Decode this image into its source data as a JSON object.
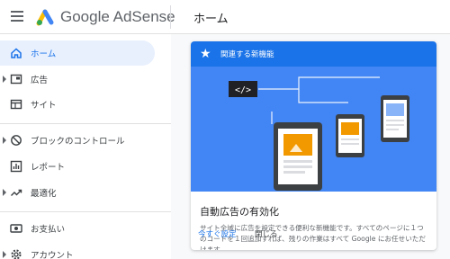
{
  "header": {
    "brand": "Google AdSense",
    "page_title": "ホーム"
  },
  "sidebar": {
    "items": [
      {
        "label": "ホーム",
        "icon": "home-icon",
        "active": true
      },
      {
        "label": "広告",
        "icon": "ads-icon",
        "expandable": true
      },
      {
        "label": "サイト",
        "icon": "sites-icon"
      },
      {
        "label": "ブロックのコントロール",
        "icon": "block-icon",
        "expandable": true
      },
      {
        "label": "レポート",
        "icon": "reports-icon"
      },
      {
        "label": "最適化",
        "icon": "optimization-icon",
        "expandable": true
      },
      {
        "label": "お支払い",
        "icon": "payments-icon"
      },
      {
        "label": "アカウント",
        "icon": "account-icon",
        "expandable": true
      }
    ]
  },
  "card": {
    "tag": "関連する新機能",
    "title": "自動広告の有効化",
    "description": "サイト全域に広告を設定できる便利な新機能です。すべてのページに１つのコードを１回追加すれば、残りの作業はすべて Google にお任せいただけます。",
    "primary_action": "今すぐ設定",
    "secondary_action": "閉じる"
  },
  "colors": {
    "accent": "#1a73e8",
    "hero_background": "#4285f4",
    "active_nav_background": "#e8f0fe"
  }
}
